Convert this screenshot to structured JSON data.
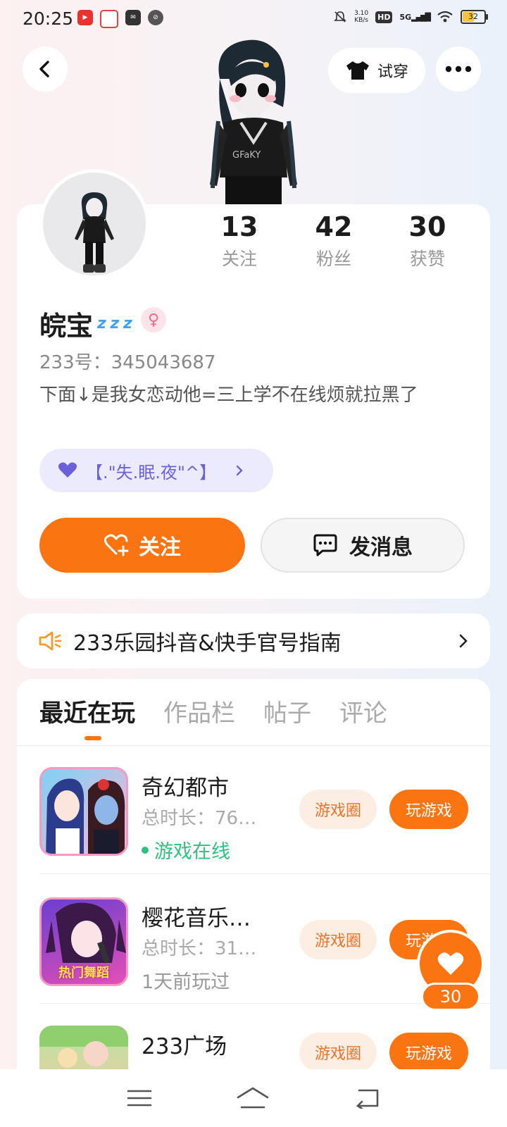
{
  "status_bar": {
    "time": "20:25",
    "net_speed_value": "3.10",
    "net_speed_unit": "KB/s",
    "hd": "HD",
    "signal": "5G",
    "battery": "32"
  },
  "header": {
    "tryon_label": "试穿"
  },
  "profile": {
    "stats": [
      {
        "value": "13",
        "label": "关注"
      },
      {
        "value": "42",
        "label": "粉丝"
      },
      {
        "value": "30",
        "label": "获赞"
      }
    ],
    "nickname": "皖宝",
    "nickname_emoji": "z z z",
    "gender_symbol": "♀",
    "user_id": "233号：345043687",
    "bio": "下面↓是我女恋动他=三上学不在线烦就拉黑了",
    "group_label": "【.\"失.眠.夜\"^】",
    "follow_label": "关注",
    "message_label": "发消息"
  },
  "announcement": {
    "text": "233乐园抖音&快手官号指南"
  },
  "tabs": [
    {
      "label": "最近在玩",
      "active": true
    },
    {
      "label": "作品栏",
      "active": false
    },
    {
      "label": "帖子",
      "active": false
    },
    {
      "label": "评论",
      "active": false
    }
  ],
  "games": [
    {
      "title": "奇幻都市",
      "duration": "总时长：76…",
      "status": "游戏在线",
      "online": true,
      "circle_label": "游戏圈",
      "play_label": "玩游戏"
    },
    {
      "title": "樱花音乐…",
      "duration": "总时长：31…",
      "status": "1天前玩过",
      "online": false,
      "circle_label": "游戏圈",
      "play_label": "玩游戏",
      "icon_text": "热门舞蹈"
    },
    {
      "title": "233广场",
      "duration": "",
      "status": "",
      "online": false,
      "circle_label": "游戏圈",
      "play_label": "玩游戏"
    }
  ],
  "like_fab": {
    "count": "30"
  },
  "colors": {
    "accent": "#fb7412",
    "group_pill_bg": "#ecebfd",
    "group_pill_text": "#6b62d9",
    "online": "#2ec27e"
  }
}
